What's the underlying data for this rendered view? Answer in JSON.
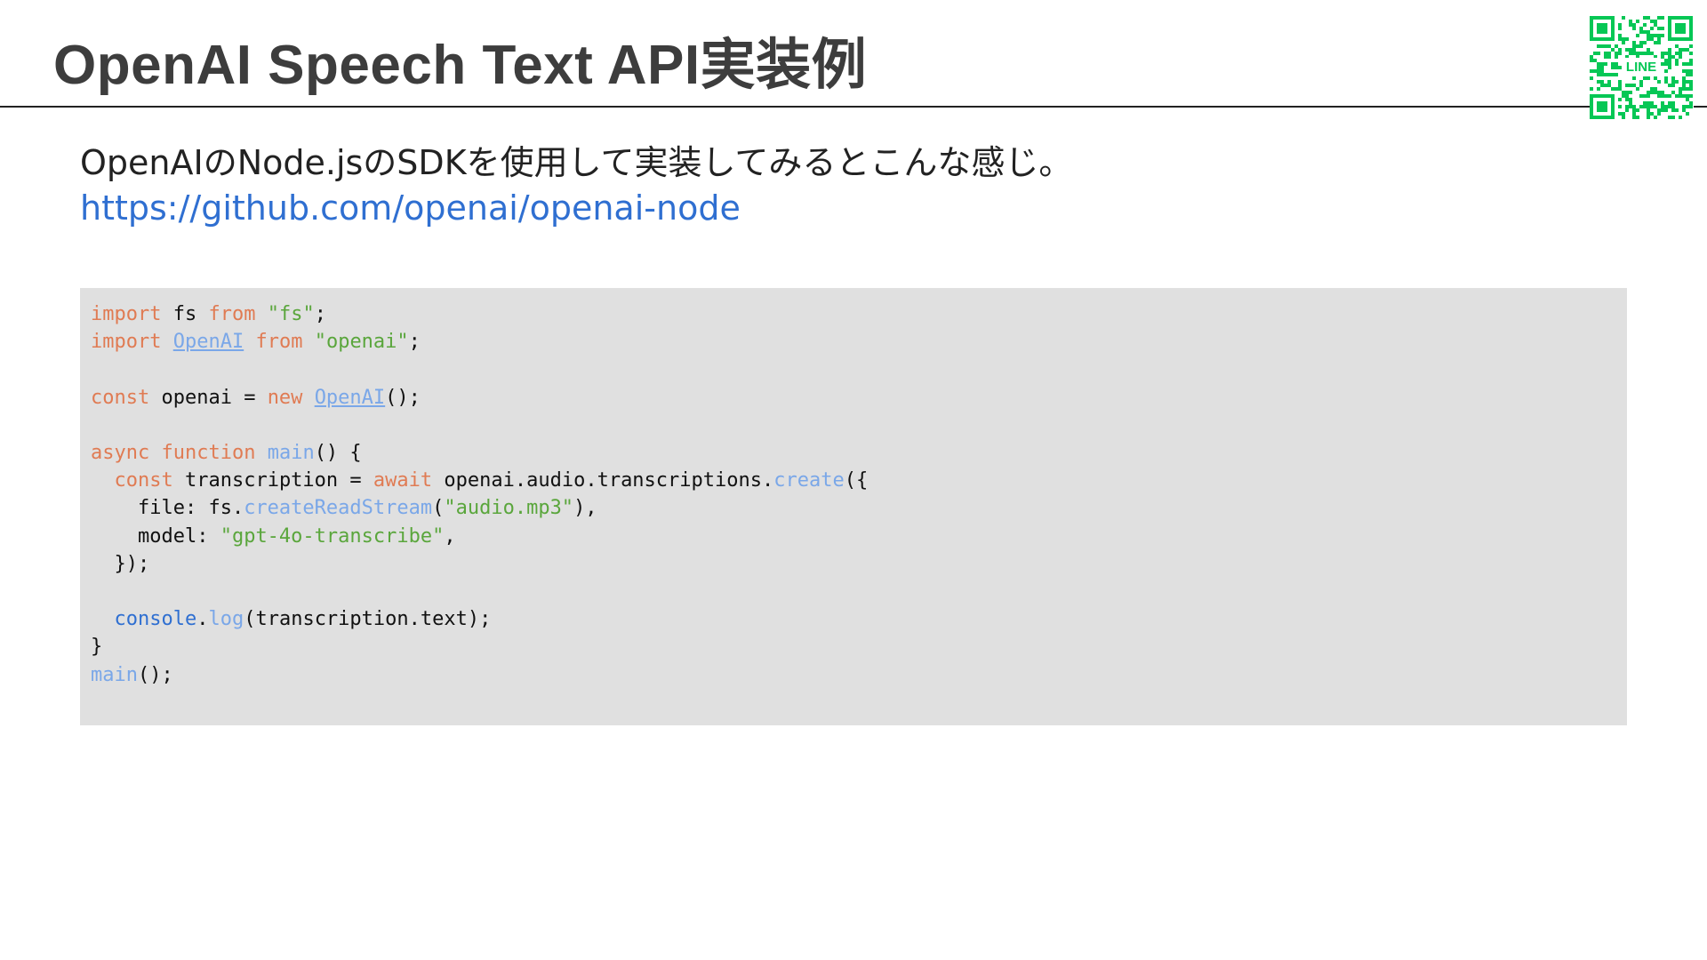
{
  "title": "OpenAI Speech Text API実装例",
  "intro": "OpenAIのNode.jsのSDKを使用して実装してみるとこんな感じ。",
  "link_text": "https://github.com/openai/openai-node",
  "qr": {
    "badge": "LINE",
    "color": "#06c755"
  },
  "colors": {
    "keyword": "#e07b53",
    "string": "#5aa63c",
    "function": "#7aa7e8",
    "link": "#2f6fd1",
    "code_background": "#e0e0e0"
  },
  "code": [
    [
      [
        "kw",
        "import"
      ],
      [
        "pl",
        " fs "
      ],
      [
        "kw",
        "from"
      ],
      [
        "pl",
        " "
      ],
      [
        "str",
        "\"fs\""
      ],
      [
        "pl",
        ";"
      ]
    ],
    [
      [
        "kw",
        "import"
      ],
      [
        "pl",
        " "
      ],
      [
        "cls",
        "OpenAI"
      ],
      [
        "pl",
        " "
      ],
      [
        "kw",
        "from"
      ],
      [
        "pl",
        " "
      ],
      [
        "str",
        "\"openai\""
      ],
      [
        "pl",
        ";"
      ]
    ],
    [],
    [
      [
        "kw",
        "const"
      ],
      [
        "pl",
        " openai = "
      ],
      [
        "kw",
        "new"
      ],
      [
        "pl",
        " "
      ],
      [
        "cls",
        "OpenAI"
      ],
      [
        "pl",
        "();"
      ]
    ],
    [],
    [
      [
        "kw",
        "async"
      ],
      [
        "pl",
        " "
      ],
      [
        "kw",
        "function"
      ],
      [
        "pl",
        " "
      ],
      [
        "fn",
        "main"
      ],
      [
        "pl",
        "() {"
      ]
    ],
    [
      [
        "pl",
        "  "
      ],
      [
        "kw",
        "const"
      ],
      [
        "pl",
        " transcription = "
      ],
      [
        "kw",
        "await"
      ],
      [
        "pl",
        " openai.audio.transcriptions."
      ],
      [
        "fn",
        "create"
      ],
      [
        "pl",
        "({"
      ]
    ],
    [
      [
        "pl",
        "    file: fs."
      ],
      [
        "fn",
        "createReadStream"
      ],
      [
        "pl",
        "("
      ],
      [
        "str",
        "\"audio.mp3\""
      ],
      [
        "pl",
        "),"
      ]
    ],
    [
      [
        "pl",
        "    model: "
      ],
      [
        "str",
        "\"gpt-4o-transcribe\""
      ],
      [
        "pl",
        ","
      ]
    ],
    [
      [
        "pl",
        "  });"
      ]
    ],
    [],
    [
      [
        "pl",
        "  "
      ],
      [
        "obj",
        "console"
      ],
      [
        "pl",
        "."
      ],
      [
        "fn",
        "log"
      ],
      [
        "pl",
        "(transcription.text);"
      ]
    ],
    [
      [
        "pl",
        "}"
      ]
    ],
    [
      [
        "fn",
        "main"
      ],
      [
        "pl",
        "();"
      ]
    ]
  ]
}
